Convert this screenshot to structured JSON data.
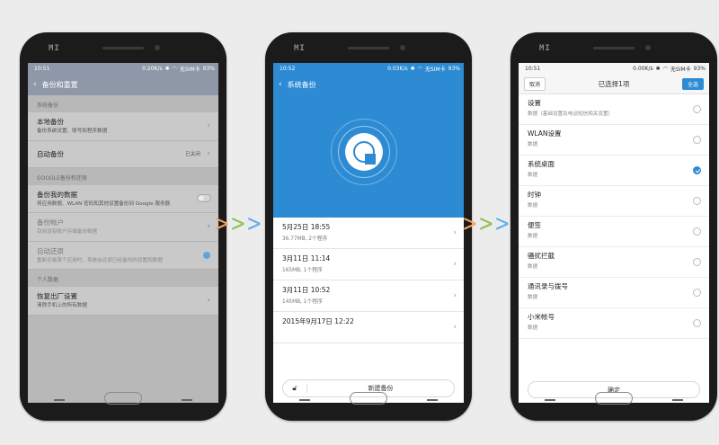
{
  "colors": {
    "accent": "#2d8bd4",
    "arrow1": "#f2a65a",
    "arrow2": "#8cc152",
    "arrow3": "#5aaee8"
  },
  "phones": {
    "brand": "MI"
  },
  "screen1": {
    "status": {
      "time": "10:51",
      "speed": "0.20K/s",
      "carrier": "无SIM卡",
      "battery": "93%"
    },
    "title": "备份和重置",
    "section1": "系统备份",
    "rows1": [
      {
        "title": "本地备份",
        "desc": "备份系统设置、账号和程序数据"
      },
      {
        "title": "自动备份",
        "value": "已关闭"
      }
    ],
    "section2": "GOOGLE备份和还原",
    "rows2": [
      {
        "title": "备份我的数据",
        "desc": "将应用数据、WLAN 密码和其他设置备份到 Google 服务器"
      },
      {
        "title": "备份帐户",
        "desc": "目前没有帐户存储备份数据"
      },
      {
        "title": "自动还原",
        "desc": "重新安装某个应用时，系统会还原已经备份的设置和数据"
      }
    ],
    "section3": "个人数据",
    "rows3": [
      {
        "title": "恢复出厂设置",
        "desc": "清除手机上的所有数据"
      }
    ]
  },
  "screen2": {
    "status": {
      "time": "10:52",
      "speed": "0.03K/s",
      "carrier": "无SIM卡",
      "battery": "93%"
    },
    "title": "系统备份",
    "backups": [
      {
        "date": "5月25日 18:55",
        "info": "36.77MB, 2个程序"
      },
      {
        "date": "3月11日 11:14",
        "info": "165MB, 1个程序"
      },
      {
        "date": "3月11日 10:52",
        "info": "145MB, 1个程序"
      },
      {
        "date": "2015年9月17日 12:22",
        "info": ""
      }
    ],
    "new_backup": "新建备份"
  },
  "screen3": {
    "status": {
      "time": "10:51",
      "speed": "0.00K/s",
      "carrier": "无SIM卡",
      "battery": "93%"
    },
    "cancel": "取消",
    "title": "已选择1项",
    "select_all": "全选",
    "items": [
      {
        "title": "设置",
        "desc": "数据（基础设置及电话短信相关设置）",
        "checked": false
      },
      {
        "title": "WLAN设置",
        "desc": "数据",
        "checked": false
      },
      {
        "title": "系统桌面",
        "desc": "数据",
        "checked": true
      },
      {
        "title": "时钟",
        "desc": "数据",
        "checked": false
      },
      {
        "title": "便签",
        "desc": "数据",
        "checked": false
      },
      {
        "title": "骚扰拦截",
        "desc": "数据",
        "checked": false
      },
      {
        "title": "通讯录与拨号",
        "desc": "数据",
        "checked": false
      },
      {
        "title": "小米帐号",
        "desc": "数据",
        "checked": false
      }
    ],
    "confirm": "确定"
  }
}
